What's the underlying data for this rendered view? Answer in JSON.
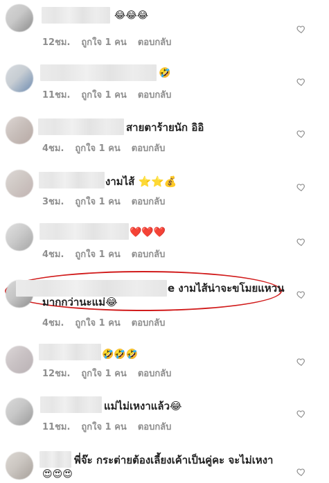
{
  "comments": [
    {
      "text": "😂😂😂",
      "time": "12ชม.",
      "likes": "ถูกใจ 1 คน",
      "reply": "ตอบกลับ"
    },
    {
      "text": "🤣",
      "time": "11ชม.",
      "likes": "ถูกใจ 1 คน",
      "reply": "ตอบกลับ"
    },
    {
      "text": "สายตาร้ายนัก อิอิ",
      "time": "4ชม.",
      "likes": "ถูกใจ 1 คน",
      "reply": "ตอบกลับ"
    },
    {
      "text": "งามไส้ ⭐⭐💰",
      "time": "3ชม.",
      "likes": "ถูกใจ 1 คน",
      "reply": "ตอบกลับ"
    },
    {
      "text": "❤️❤️❤️",
      "time": "4ชม.",
      "likes": "ถูกใจ 1 คน",
      "reply": "ตอบกลับ"
    },
    {
      "text_line1": "e งามไส้น่าจะขโมยแหวน",
      "text_line2": "มากกว่านะแม่😂",
      "time": "4ชม.",
      "likes": "ถูกใจ 1 คน",
      "reply": "ตอบกลับ"
    },
    {
      "text": "🤣🤣🤣",
      "time": "12ชม.",
      "likes": "ถูกใจ 1 คน",
      "reply": "ตอบกลับ"
    },
    {
      "text": "แม่ไม่เหงาแล้ว😂",
      "time": "11ชม.",
      "likes": "ถูกใจ 1 คน",
      "reply": "ตอบกลับ"
    },
    {
      "text_line1": "พี่จ๊ะ กระต่ายต้องเลี้ยงเค้าเป็นคู่คะ จะไม่เหงา",
      "text_line2": "😍😍😍"
    }
  ],
  "icons": {
    "like": "heart-outline-icon"
  },
  "colors": {
    "highlight": "#d11b1b",
    "meta_text": "#8e8e8e"
  }
}
